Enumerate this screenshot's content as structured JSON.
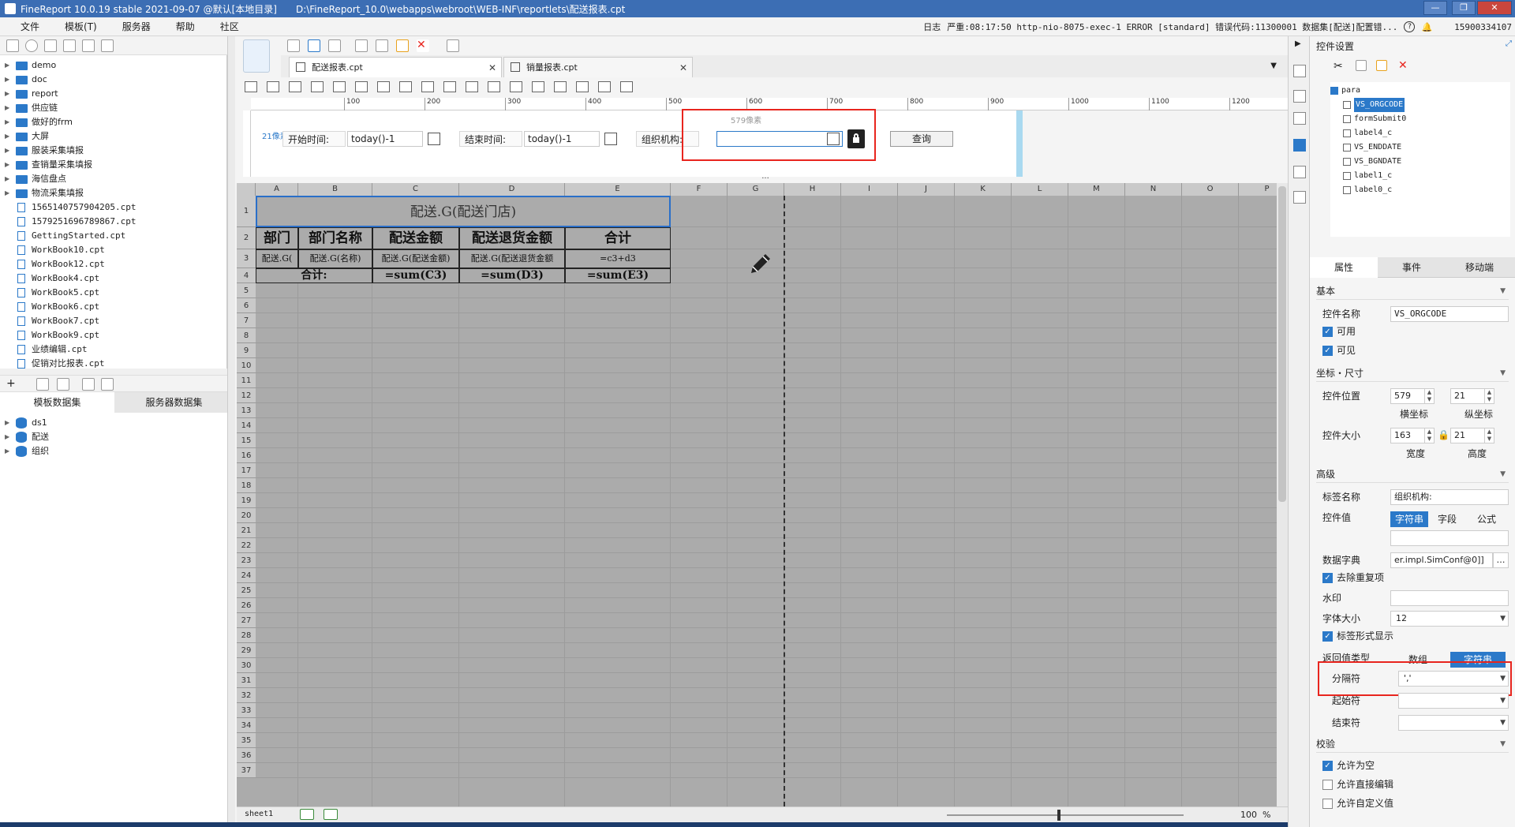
{
  "titlebar": {
    "title": "FineReport 10.0.19 stable 2021-09-07 @默认[本地目录]",
    "path": "D:\\FineReport_10.0\\webapps\\webroot\\WEB-INF\\reportlets\\配送报表.cpt"
  },
  "menu": {
    "items": [
      "文件",
      "模板(T)",
      "服务器",
      "帮助",
      "社区"
    ],
    "status": [
      "日志",
      "严重:08:17:50 http-nio-8075-exec-1 ERROR [standard] 错误代码:11300001 数据集[配送]配置错...",
      "15900334107"
    ]
  },
  "tree": {
    "items": [
      {
        "type": "folder",
        "label": "demo"
      },
      {
        "type": "folder",
        "label": "doc"
      },
      {
        "type": "folder",
        "label": "report"
      },
      {
        "type": "folder",
        "label": "供应链"
      },
      {
        "type": "folder",
        "label": "做好的frm"
      },
      {
        "type": "folder",
        "label": "大屏"
      },
      {
        "type": "folder",
        "label": "服装采集填报"
      },
      {
        "type": "folder",
        "label": "查销量采集填报"
      },
      {
        "type": "folder",
        "label": "海信盘点"
      },
      {
        "type": "folder",
        "label": "物流采集填报"
      },
      {
        "type": "file",
        "label": "1565140757904205.cpt"
      },
      {
        "type": "file",
        "label": "1579251696789867.cpt"
      },
      {
        "type": "file",
        "label": "GettingStarted.cpt"
      },
      {
        "type": "file",
        "label": "WorkBook10.cpt"
      },
      {
        "type": "file",
        "label": "WorkBook12.cpt"
      },
      {
        "type": "file",
        "label": "WorkBook4.cpt"
      },
      {
        "type": "file",
        "label": "WorkBook5.cpt"
      },
      {
        "type": "file",
        "label": "WorkBook6.cpt"
      },
      {
        "type": "file",
        "label": "WorkBook7.cpt"
      },
      {
        "type": "file",
        "label": "WorkBook9.cpt"
      },
      {
        "type": "file",
        "label": "业绩编辑.cpt"
      },
      {
        "type": "file",
        "label": "促销对比报表.cpt"
      }
    ]
  },
  "datasets": {
    "tabs": [
      "模板数据集",
      "服务器数据集"
    ],
    "items": [
      "ds1",
      "配送",
      "组织"
    ]
  },
  "filetabs": [
    "配送报表.cpt",
    "销量报表.cpt"
  ],
  "ruler": [
    "100",
    "200",
    "300",
    "400",
    "500",
    "600",
    "700",
    "800",
    "900",
    "1000",
    "1100",
    "1200"
  ],
  "param": {
    "vruler": "21像素",
    "hint": "579像素",
    "start_label": "开始时间:",
    "start_value": "today()-1",
    "end_label": "结束时间:",
    "end_value": "today()-1",
    "org_label": "组织机构:",
    "query_label": "查询"
  },
  "sheet": {
    "columns": [
      "A",
      "B",
      "C",
      "D",
      "E",
      "F",
      "G",
      "H",
      "I",
      "J",
      "K",
      "L",
      "M",
      "N",
      "O",
      "P"
    ],
    "rows": [
      "1",
      "2",
      "3",
      "4",
      "5",
      "6",
      "7",
      "8",
      "9",
      "10",
      "11",
      "12",
      "13",
      "14",
      "15",
      "16",
      "17",
      "18",
      "19",
      "20",
      "21",
      "22",
      "23",
      "24",
      "25",
      "26",
      "27",
      "28",
      "29",
      "30",
      "31",
      "32",
      "33",
      "34",
      "35",
      "36",
      "37"
    ],
    "title": "配送.G(配送门店)",
    "headers": [
      "部门",
      "部门名称",
      "配送金额",
      "配送退货金额",
      "合计"
    ],
    "row3": [
      "配送.G(",
      "配送.G(名称)",
      "配送.G(配送金额)",
      "配送.G(配送退货金额",
      "=c3+d3"
    ],
    "total_label": "合计:",
    "totals": [
      "=sum(C3)",
      "=sum(D3)",
      "=sum(E3)"
    ],
    "sheet_name": "sheet1",
    "zoom": "100"
  },
  "panel": {
    "title": "控件设置",
    "controls": [
      {
        "label": "para",
        "sel": false,
        "indent": 0
      },
      {
        "label": "VS_ORGCODE",
        "sel": true,
        "indent": 16
      },
      {
        "label": "formSubmit0",
        "sel": false,
        "indent": 16
      },
      {
        "label": "label4_c",
        "sel": false,
        "indent": 16
      },
      {
        "label": "VS_ENDDATE",
        "sel": false,
        "indent": 16
      },
      {
        "label": "VS_BGNDATE",
        "sel": false,
        "indent": 16
      },
      {
        "label": "label1_c",
        "sel": false,
        "indent": 16
      },
      {
        "label": "label0_c",
        "sel": false,
        "indent": 16
      }
    ],
    "tabs": [
      "属性",
      "事件",
      "移动端"
    ],
    "basic": "基本",
    "name_label": "控件名称",
    "name_value": "VS_ORGCODE",
    "enabled": "可用",
    "visible": "可见",
    "coord": "坐标・尺寸",
    "pos_label": "控件位置",
    "pos_x": "579",
    "pos_y": "21",
    "x_label": "横坐标",
    "y_label": "纵坐标",
    "size_label": "控件大小",
    "width": "163",
    "height": "21",
    "w_label": "宽度",
    "h_label": "高度",
    "advanced": "高级",
    "tag_label": "标签名称",
    "tag_value": "组织机构:",
    "value_label": "控件值",
    "value_tabs": [
      "字符串",
      "字段",
      "公式"
    ],
    "dict_label": "数据字典",
    "dict_value": "er.impl.SimConf@0]]",
    "dedup": "去除重复项",
    "watermark": "水印",
    "fontsize_label": "字体大小",
    "fontsize": "12",
    "tagform": "标签形式显示",
    "return_label": "返回值类型",
    "return_tabs": [
      "数组",
      "字符串"
    ],
    "sep_label": "分隔符",
    "sep_value": "','",
    "start_label": "起始符",
    "end_label": "结束符",
    "verify": "校验",
    "allow_empty": "允许为空",
    "allow_edit": "允许直接编辑",
    "allow_custom": "允许自定义值"
  }
}
